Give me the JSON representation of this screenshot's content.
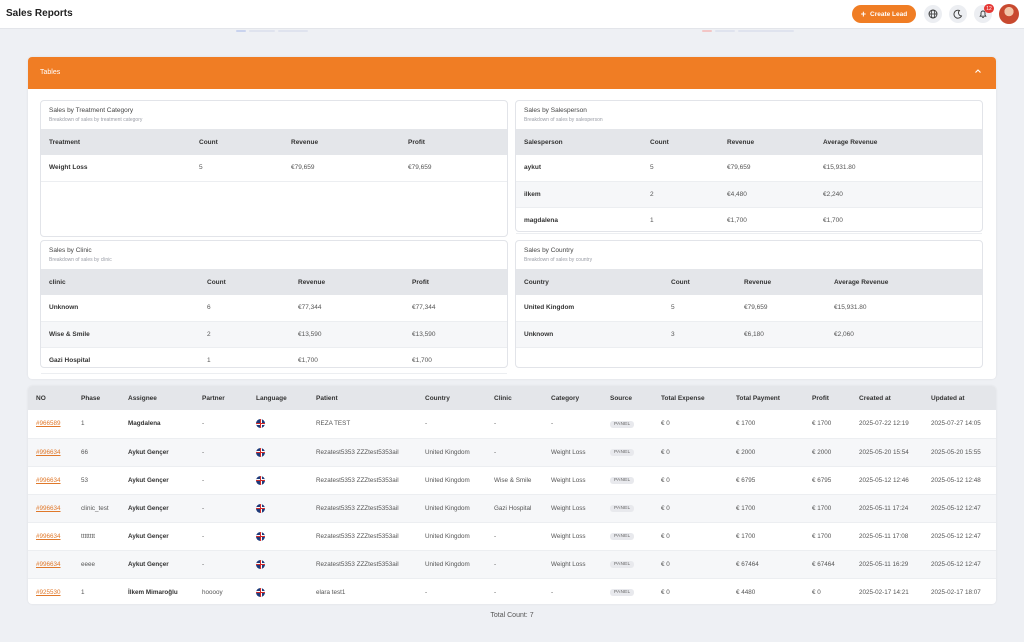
{
  "header": {
    "title": "Sales Reports",
    "create_label": "Create Lead",
    "notification_count": "12"
  },
  "tables_card": {
    "title": "Tables"
  },
  "treatment": {
    "title": "Sales by Treatment Category",
    "subtitle": "Breakdown of sales by treatment category",
    "columns": [
      "Treatment",
      "Count",
      "Revenue",
      "Profit"
    ],
    "rows": [
      [
        "Weight Loss",
        "5",
        "€79,659",
        "€79,659"
      ]
    ]
  },
  "salesperson": {
    "title": "Sales by Salesperson",
    "subtitle": "Breakdown of sales by salesperson",
    "columns": [
      "Salesperson",
      "Count",
      "Revenue",
      "Average Revenue"
    ],
    "rows": [
      [
        "aykut",
        "5",
        "€79,659",
        "€15,931.80"
      ],
      [
        "ilkem",
        "2",
        "€4,480",
        "€2,240"
      ],
      [
        "magdalena",
        "1",
        "€1,700",
        "€1,700"
      ]
    ]
  },
  "clinic": {
    "title": "Sales by Clinic",
    "subtitle": "Breakdown of sales by clinic",
    "columns": [
      "clinic",
      "Count",
      "Revenue",
      "Profit"
    ],
    "rows": [
      [
        "Unknown",
        "6",
        "€77,344",
        "€77,344"
      ],
      [
        "Wise & Smile",
        "2",
        "€13,590",
        "€13,590"
      ],
      [
        "Gazi Hospital",
        "1",
        "€1,700",
        "€1,700"
      ]
    ]
  },
  "country": {
    "title": "Sales by Country",
    "subtitle": "Breakdown of sales by country",
    "columns": [
      "Country",
      "Count",
      "Revenue",
      "Average Revenue"
    ],
    "rows": [
      [
        "United Kingdom",
        "5",
        "€79,659",
        "€15,931.80"
      ],
      [
        "Unknown",
        "3",
        "€6,180",
        "€2,060"
      ]
    ]
  },
  "leads": {
    "columns": [
      "NO",
      "Phase",
      "Assignee",
      "Partner",
      "Language",
      "Patient",
      "Country",
      "Clinic",
      "Category",
      "Source",
      "Total Expense",
      "Total Payment",
      "Profit",
      "Created at",
      "Updated at"
    ],
    "rows": [
      {
        "no": "#966589",
        "phase": "1",
        "assignee": "Magdalena",
        "partner": "-",
        "patient": "REZA TEST",
        "country": "-",
        "clinic": "-",
        "category": "-",
        "source": "PANEL",
        "expense": "€ 0",
        "payment": "€ 1700",
        "profit": "€ 1700",
        "created": "2025-07-22 12:19",
        "updated": "2025-07-27 14:05"
      },
      {
        "no": "#996634",
        "phase": "66",
        "assignee": "Aykut Gençer",
        "partner": "-",
        "patient": "Rezatest5353 ZZZtest5353ail",
        "country": "United Kingdom",
        "clinic": "-",
        "category": "Weight Loss",
        "source": "PANEL",
        "expense": "€ 0",
        "payment": "€ 2000",
        "profit": "€ 2000",
        "created": "2025-05-20 15:54",
        "updated": "2025-05-20 15:55"
      },
      {
        "no": "#996634",
        "phase": "53",
        "assignee": "Aykut Gençer",
        "partner": "-",
        "patient": "Rezatest5353 ZZZtest5353ail",
        "country": "United Kingdom",
        "clinic": "Wise & Smile",
        "category": "Weight Loss",
        "source": "PANEL",
        "expense": "€ 0",
        "payment": "€ 6795",
        "profit": "€ 6795",
        "created": "2025-05-12 12:46",
        "updated": "2025-05-12 12:48"
      },
      {
        "no": "#996634",
        "phase": "clinic_test",
        "assignee": "Aykut Gençer",
        "partner": "-",
        "patient": "Rezatest5353 ZZZtest5353ail",
        "country": "United Kingdom",
        "clinic": "Gazi Hospital",
        "category": "Weight Loss",
        "source": "PANEL",
        "expense": "€ 0",
        "payment": "€ 1700",
        "profit": "€ 1700",
        "created": "2025-05-11 17:24",
        "updated": "2025-05-12 12:47"
      },
      {
        "no": "#996634",
        "phase": "tttttttt",
        "assignee": "Aykut Gençer",
        "partner": "-",
        "patient": "Rezatest5353 ZZZtest5353ail",
        "country": "United Kingdom",
        "clinic": "-",
        "category": "Weight Loss",
        "source": "PANEL",
        "expense": "€ 0",
        "payment": "€ 1700",
        "profit": "€ 1700",
        "created": "2025-05-11 17:08",
        "updated": "2025-05-12 12:47"
      },
      {
        "no": "#996634",
        "phase": "eeee",
        "assignee": "Aykut Gençer",
        "partner": "-",
        "patient": "Rezatest5353 ZZZtest5353ail",
        "country": "United Kingdom",
        "clinic": "-",
        "category": "Weight Loss",
        "source": "PANEL",
        "expense": "€ 0",
        "payment": "€ 67464",
        "profit": "€ 67464",
        "created": "2025-05-11 16:29",
        "updated": "2025-05-12 12:47"
      },
      {
        "no": "#925530",
        "phase": "1",
        "assignee": "İlkem Mimaroğlu",
        "partner": "hooooy",
        "patient": "elara test1",
        "country": "-",
        "clinic": "-",
        "category": "-",
        "source": "PANEL",
        "expense": "€ 0",
        "payment": "€ 4480",
        "profit": "€ 0",
        "created": "2025-02-17 14:21",
        "updated": "2025-02-17 18:07"
      }
    ]
  },
  "footer": {
    "total_count": "Total Count: 7"
  },
  "colors": {
    "accent": "#f07d24",
    "link": "#e0782a"
  }
}
